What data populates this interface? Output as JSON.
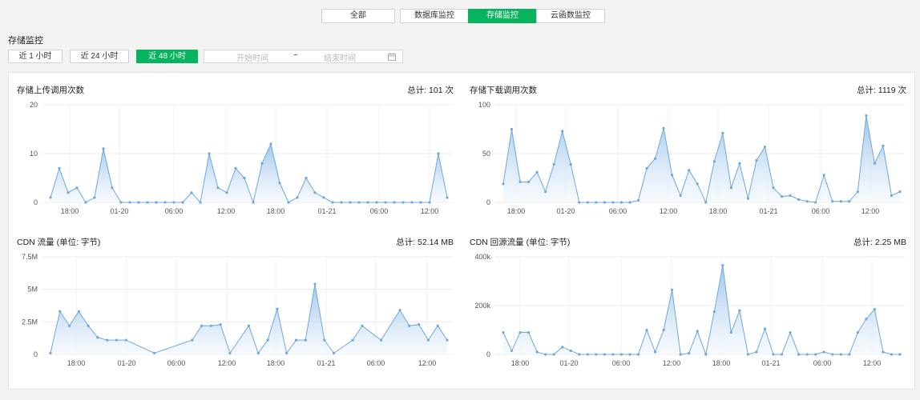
{
  "tabs": [
    {
      "label": "全部",
      "active": false
    },
    {
      "label": "数据库监控",
      "active": false
    },
    {
      "label": "存储监控",
      "active": true
    },
    {
      "label": "云函数监控",
      "active": false
    }
  ],
  "section_title": "存储监控",
  "time_filters": [
    {
      "label": "近 1 小时",
      "active": false
    },
    {
      "label": "近 24 小时",
      "active": false
    },
    {
      "label": "近 48 小时",
      "active": true
    }
  ],
  "date_range": {
    "start_placeholder": "开始时间",
    "separator": "~",
    "end_placeholder": "结束时间",
    "icon": "calendar-icon"
  },
  "colors": {
    "accent": "#07b35e",
    "line": "#6ea8dc",
    "fill_top": "#9cc4ea",
    "fill_bottom": "#f2f7fd"
  },
  "charts": [
    {
      "title": "存储上传调用次数",
      "total": "总计: 101 次"
    },
    {
      "title": "存储下载调用次数",
      "total": "总计: 1119 次"
    },
    {
      "title": "CDN 流量 (单位: 字节)",
      "total": "总计: 52.14 MB"
    },
    {
      "title": "CDN 回源流量 (单位: 字节)",
      "total": "总计: 2.25 MB"
    }
  ],
  "chart_data": [
    {
      "type": "area",
      "title": "存储上传调用次数",
      "y_ticks": [
        "20",
        "10",
        "0"
      ],
      "ylim": [
        0,
        20
      ],
      "x_tick_labels": [
        "18:00",
        "01-20",
        "06:00",
        "12:00",
        "18:00",
        "01-21",
        "06:00",
        "12:00"
      ],
      "x": [
        "17:00",
        "18:00",
        "19:00",
        "20:00",
        "21:00",
        "22:00",
        "23:00",
        "01-20 00:00",
        "01:00",
        "02:00",
        "03:00",
        "04:00",
        "05:00",
        "06:00",
        "07:00",
        "08:00",
        "09:00",
        "10:00",
        "11:00",
        "12:00",
        "13:00",
        "14:00",
        "15:00",
        "16:00",
        "17:00",
        "18:00",
        "19:00",
        "20:00",
        "21:00",
        "22:00",
        "23:00",
        "01-21 00:00",
        "01:00",
        "02:00",
        "03:00",
        "04:00",
        "05:00",
        "06:00",
        "07:00",
        "08:00",
        "09:00",
        "10:00",
        "11:00",
        "12:00",
        "13:00",
        "14:00"
      ],
      "values": [
        1,
        7,
        2,
        3,
        0,
        1,
        11,
        3,
        0,
        0,
        0,
        0,
        0,
        0,
        0,
        0,
        2,
        0,
        10,
        3,
        2,
        7,
        5,
        0,
        8,
        12,
        4,
        0,
        1,
        5,
        2,
        1,
        0,
        0,
        0,
        0,
        0,
        0,
        0,
        0,
        0,
        0,
        0,
        0,
        10,
        1
      ],
      "grid": true
    },
    {
      "type": "area",
      "title": "存储下载调用次数",
      "y_ticks": [
        "100",
        "50",
        "0"
      ],
      "ylim": [
        0,
        100
      ],
      "x_tick_labels": [
        "18:00",
        "01-20",
        "06:00",
        "12:00",
        "18:00",
        "01-21",
        "06:00",
        "12:00"
      ],
      "x": [
        "17:00",
        "18:00",
        "19:00",
        "20:00",
        "21:00",
        "22:00",
        "23:00",
        "01-20 00:00",
        "01:00",
        "02:00",
        "03:00",
        "04:00",
        "05:00",
        "06:00",
        "07:00",
        "08:00",
        "09:00",
        "10:00",
        "11:00",
        "12:00",
        "13:00",
        "14:00",
        "15:00",
        "16:00",
        "17:00",
        "18:00",
        "19:00",
        "20:00",
        "21:00",
        "22:00",
        "23:00",
        "01-21 00:00",
        "01:00",
        "02:00",
        "03:00",
        "04:00",
        "05:00",
        "06:00",
        "07:00",
        "08:00",
        "09:00",
        "10:00",
        "11:00",
        "12:00",
        "13:00",
        "14:00"
      ],
      "values": [
        19,
        75,
        21,
        21,
        31,
        11,
        39,
        73,
        39,
        0,
        0,
        0,
        0,
        0,
        0,
        0,
        2,
        35,
        45,
        76,
        28,
        7,
        33,
        19,
        0,
        42,
        71,
        15,
        40,
        4,
        43,
        57,
        15,
        6,
        7,
        3,
        1,
        0,
        28,
        1,
        1,
        1,
        11,
        89,
        40,
        58,
        7,
        11
      ],
      "grid": true
    },
    {
      "type": "area",
      "title": "CDN 流量 (单位: 字节)",
      "y_ticks": [
        "7.5M",
        "5M",
        "2.5M",
        "0"
      ],
      "ylim": [
        0,
        7.5
      ],
      "y_unit": "M",
      "x_tick_labels": [
        "18:00",
        "01-20",
        "06:00",
        "12:00",
        "18:00",
        "01-21",
        "06:00",
        "12:00"
      ],
      "x_hours": [
        0,
        1,
        2,
        3,
        4,
        5,
        6,
        7,
        8,
        11,
        15,
        16,
        17,
        18,
        19,
        21,
        22,
        23,
        24,
        25,
        26,
        27,
        28,
        29,
        30,
        32,
        33,
        35,
        37,
        38,
        39,
        40,
        41,
        42
      ],
      "values": [
        0.1,
        3.3,
        2.2,
        3.3,
        2.2,
        1.3,
        1.1,
        1.1,
        1.1,
        0.1,
        1.1,
        2.2,
        2.2,
        2.3,
        0.1,
        2.2,
        0.1,
        1.1,
        3.5,
        0.1,
        1.1,
        1.1,
        5.4,
        1.1,
        0.1,
        1.1,
        2.2,
        1.1,
        3.4,
        2.2,
        2.3,
        1.1,
        2.2,
        1.1
      ],
      "grid": true
    },
    {
      "type": "area",
      "title": "CDN 回源流量 (单位: 字节)",
      "y_ticks": [
        "400k",
        "200k",
        "0"
      ],
      "ylim": [
        0,
        400
      ],
      "y_unit": "k",
      "x_tick_labels": [
        "18:00",
        "01-20",
        "06:00",
        "12:00",
        "18:00",
        "01-21",
        "06:00",
        "12:00"
      ],
      "values": [
        90,
        15,
        90,
        90,
        10,
        0,
        0,
        30,
        15,
        0,
        0,
        0,
        0,
        0,
        0,
        0,
        0,
        100,
        10,
        100,
        265,
        0,
        5,
        95,
        0,
        175,
        365,
        90,
        180,
        0,
        10,
        105,
        0,
        0,
        90,
        0,
        0,
        0,
        10,
        0,
        0,
        0,
        90,
        145,
        185,
        10,
        0,
        0
      ],
      "grid": true
    }
  ]
}
